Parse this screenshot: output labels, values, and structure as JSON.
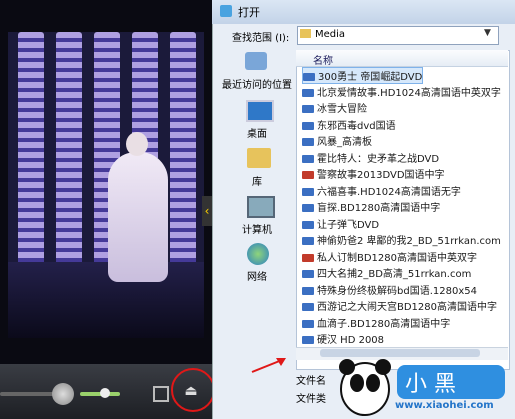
{
  "dialog": {
    "title": "打开",
    "look_in_label": "查找范围 (I):",
    "look_in_value": "Media"
  },
  "places": [
    {
      "label": "最近访问的位置",
      "icon": "recent-places-icon"
    },
    {
      "label": "桌面",
      "icon": "desktop-icon"
    },
    {
      "label": "库",
      "icon": "library-icon"
    },
    {
      "label": "计算机",
      "icon": "computer-icon"
    },
    {
      "label": "网络",
      "icon": "network-icon"
    }
  ],
  "file_list": {
    "column_header": "名称",
    "files": [
      {
        "name": "300勇士 帝国崛起DVD",
        "icon_color": "#3b6fc2",
        "selected": true
      },
      {
        "name": "北京爱情故事.HD1024高清国语中英双字",
        "icon_color": "#3b6fc2"
      },
      {
        "name": "冰雪大冒险",
        "icon_color": "#3b6fc2"
      },
      {
        "name": "东邪西毒dvd国语",
        "icon_color": "#3b6fc2"
      },
      {
        "name": "风暴_高清板",
        "icon_color": "#3b6fc2"
      },
      {
        "name": "霍比特人：史矛革之战DVD",
        "icon_color": "#3b6fc2"
      },
      {
        "name": "警察故事2013DVD国语中字",
        "icon_color": "#c23b2b"
      },
      {
        "name": "六福喜事.HD1024高清国语无字",
        "icon_color": "#3b6fc2"
      },
      {
        "name": "盲探.BD1280高清国语中字",
        "icon_color": "#3b6fc2"
      },
      {
        "name": "让子弹飞DVD",
        "icon_color": "#3b6fc2"
      },
      {
        "name": "神偷奶爸2 卑鄙的我2_BD_51rrkan.com",
        "icon_color": "#3b6fc2"
      },
      {
        "name": "私人订制BD1280高清国语中英双字",
        "icon_color": "#c23b2b"
      },
      {
        "name": "四大名捕2_BD高清_51rrkan.com",
        "icon_color": "#3b6fc2"
      },
      {
        "name": "特殊身份终极解码bd国语.1280x54",
        "icon_color": "#3b6fc2"
      },
      {
        "name": "西游记之大闹天宫BD1280高清国语中字",
        "icon_color": "#3b6fc2"
      },
      {
        "name": "血滴子.BD1280高清国语中字",
        "icon_color": "#3b6fc2"
      },
      {
        "name": "硬汉 HD 2008",
        "icon_color": "#3b6fc2"
      }
    ]
  },
  "bottom": {
    "file_name_label": "文件名",
    "file_type_label": "文件类"
  },
  "watermark": {
    "site": "www.xiaohei.com"
  },
  "colors": {
    "annotation_red": "#e01818",
    "volume_green": "#9ad16b"
  }
}
